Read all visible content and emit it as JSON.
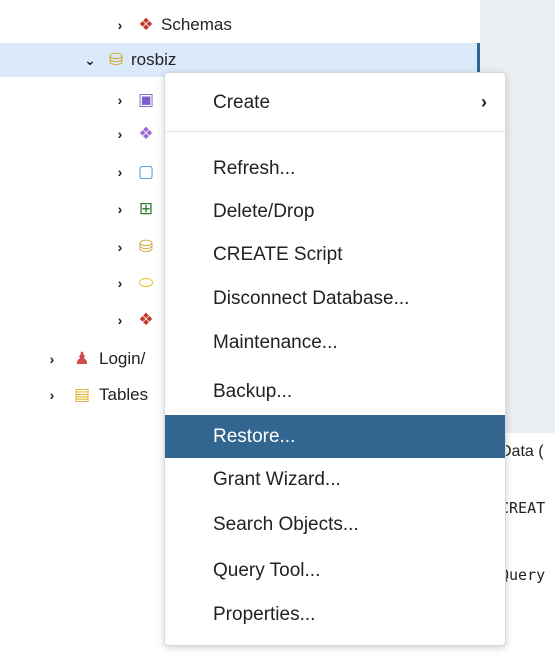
{
  "tree": {
    "items": [
      {
        "label": "Schemas",
        "icon": "schemas-icon"
      },
      {
        "label": "rosbiz",
        "icon": "database-icon"
      },
      {
        "label": "",
        "icon": "cast-icon"
      },
      {
        "label": "",
        "icon": "catalog-icon"
      },
      {
        "label": "",
        "icon": "event-trigger-icon"
      },
      {
        "label": "",
        "icon": "extension-icon"
      },
      {
        "label": "",
        "icon": "foreign-data-wrapper-icon"
      },
      {
        "label": "",
        "icon": "language-icon"
      },
      {
        "label": "",
        "icon": "schema-icon"
      },
      {
        "label": "Login/",
        "icon": "login-roles-icon"
      },
      {
        "label": "Tables",
        "icon": "tablespaces-icon"
      }
    ]
  },
  "right_panel": {
    "title": "Data (",
    "line1": "CREAT",
    "line2": "Query"
  },
  "context_menu": {
    "items": [
      {
        "label": "Create",
        "has_submenu": true
      },
      {
        "label": "Refresh..."
      },
      {
        "label": "Delete/Drop"
      },
      {
        "label": "CREATE Script"
      },
      {
        "label": "Disconnect Database..."
      },
      {
        "label": "Maintenance..."
      },
      {
        "label": "Backup..."
      },
      {
        "label": "Restore...",
        "active": true
      },
      {
        "label": "Grant Wizard..."
      },
      {
        "label": "Search Objects..."
      },
      {
        "label": "Query Tool..."
      },
      {
        "label": "Properties..."
      }
    ],
    "active_color": "#326690"
  },
  "colors": {
    "selected_row": "#dbeafa",
    "accent": "#326690",
    "panel_bg": "#ebeef3"
  }
}
